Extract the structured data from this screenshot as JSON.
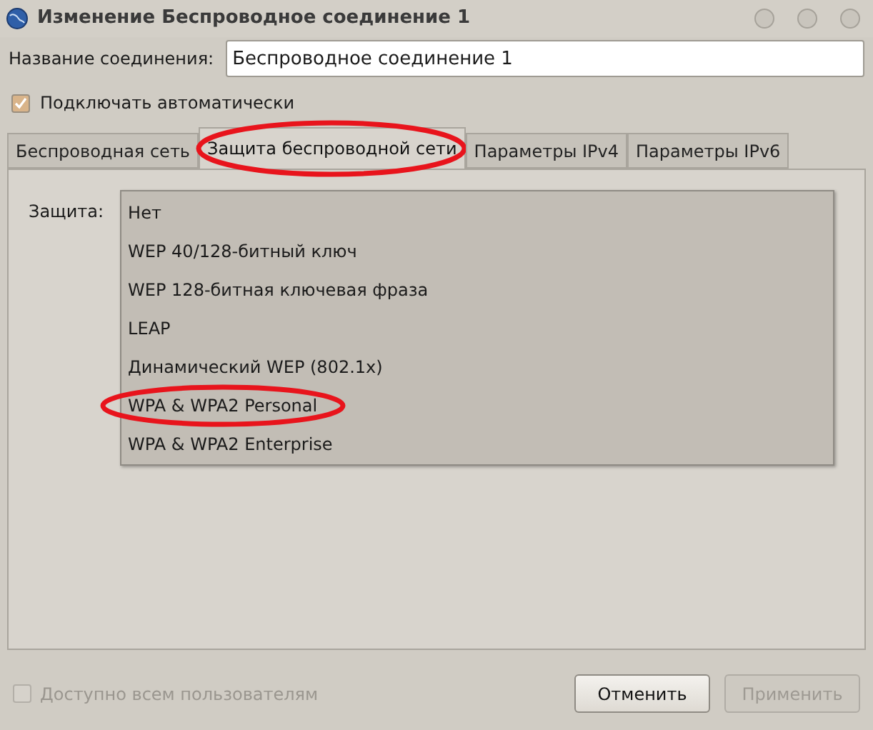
{
  "window": {
    "title": "Изменение Беспроводное соединение 1"
  },
  "connection_name": {
    "label": "Название соединения:",
    "value": "Беспроводное соединение 1"
  },
  "auto_connect": {
    "label": "Подключать автоматически",
    "checked": true
  },
  "tabs": [
    {
      "label": "Беспроводная сеть",
      "selected": false,
      "circled": false
    },
    {
      "label": "Защита беспроводной сети",
      "selected": true,
      "circled": true
    },
    {
      "label": "Параметры IPv4",
      "selected": false,
      "circled": false
    },
    {
      "label": "Параметры IPv6",
      "selected": false,
      "circled": false
    }
  ],
  "security": {
    "label": "Защита:",
    "options": [
      {
        "label": "Нет",
        "circled": false
      },
      {
        "label": "WEP 40/128-битный ключ",
        "circled": false
      },
      {
        "label": "WEP 128-битная ключевая фраза",
        "circled": false
      },
      {
        "label": "LEAP",
        "circled": false
      },
      {
        "label": "Динамический WEP (802.1x)",
        "circled": false
      },
      {
        "label": "WPA & WPA2 Personal",
        "circled": true
      },
      {
        "label": "WPA & WPA2 Enterprise",
        "circled": false
      }
    ]
  },
  "all_users": {
    "label": "Доступно всем пользователям",
    "checked": false,
    "disabled": true
  },
  "buttons": [
    {
      "label": "Отменить",
      "disabled": false
    },
    {
      "label": "Применить",
      "disabled": true
    }
  ]
}
